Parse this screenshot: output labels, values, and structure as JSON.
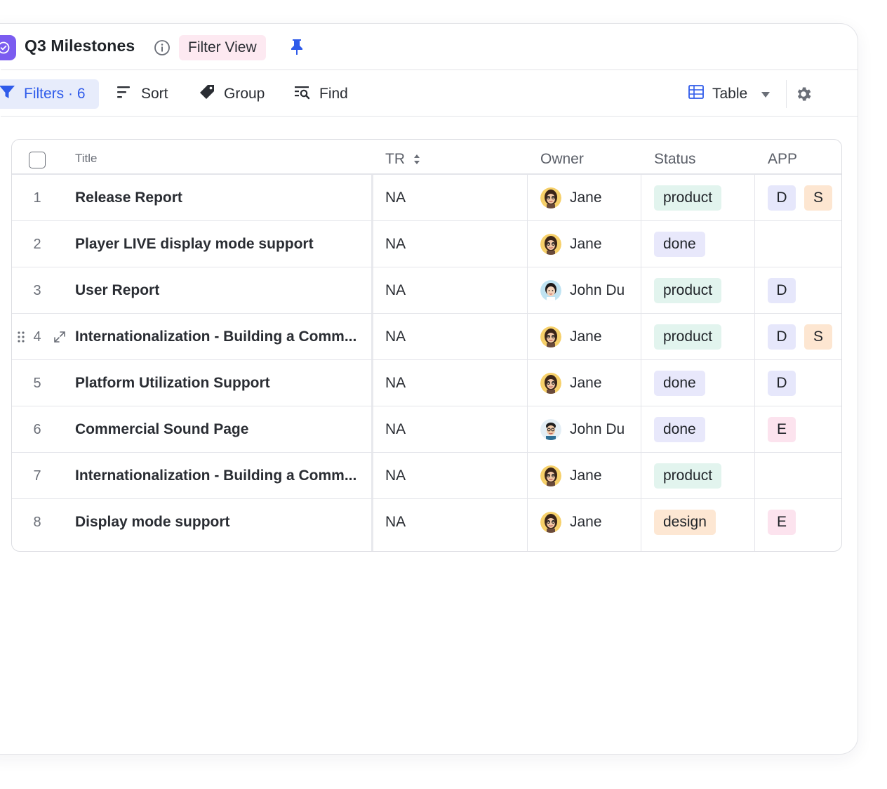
{
  "header": {
    "title": "Q3 Milestones",
    "view_badge": "Filter View",
    "icons": [
      "check-circle-icon",
      "info-icon",
      "pin-icon"
    ]
  },
  "toolbar": {
    "filters_label": "Filters · 6",
    "sort_label": "Sort",
    "group_label": "Group",
    "find_label": "Find",
    "view_label": "Table",
    "icons": [
      "funnel-icon",
      "sort-icon",
      "tag-icon",
      "find-icon",
      "table-icon",
      "caret-down-icon",
      "gear-icon"
    ]
  },
  "colors": {
    "accent": "#2f5bea",
    "app_icon": "#7b5cf0",
    "filter_view_bg": "#fde9f1",
    "product": "#e2f4ee",
    "done": "#e8e8fb",
    "design": "#fde7d3"
  },
  "table": {
    "columns": {
      "title": "Title",
      "tr": "TR",
      "owner": "Owner",
      "status": "Status",
      "app": "APP"
    },
    "rows": [
      {
        "num": "1",
        "title": "Release Report",
        "tr": "NA",
        "owner": "Jane",
        "status": "product",
        "app": [
          "D",
          "S"
        ]
      },
      {
        "num": "2",
        "title": "Player LIVE display mode support",
        "tr": "NA",
        "owner": "Jane",
        "status": "done",
        "app": []
      },
      {
        "num": "3",
        "title": "User Report",
        "tr": "NA",
        "owner": "John Du",
        "status": "product",
        "app": [
          "D"
        ]
      },
      {
        "num": "4",
        "title": "Internationalization - Building a Comm...",
        "tr": "NA",
        "owner": "Jane",
        "status": "product",
        "app": [
          "D",
          "S"
        ]
      },
      {
        "num": "5",
        "title": "Platform Utilization Support",
        "tr": "NA",
        "owner": "Jane",
        "status": "done",
        "app": [
          "D"
        ]
      },
      {
        "num": "6",
        "title": "Commercial Sound Page",
        "tr": "NA",
        "owner": "John Du",
        "status": "done",
        "app": [
          "E"
        ]
      },
      {
        "num": "7",
        "title": "Internationalization - Building a Comm...",
        "tr": "NA",
        "owner": "Jane",
        "status": "product",
        "app": []
      },
      {
        "num": "8",
        "title": "Display mode support",
        "tr": "NA",
        "owner": "Jane",
        "status": "design",
        "app": [
          "E"
        ]
      }
    ]
  }
}
